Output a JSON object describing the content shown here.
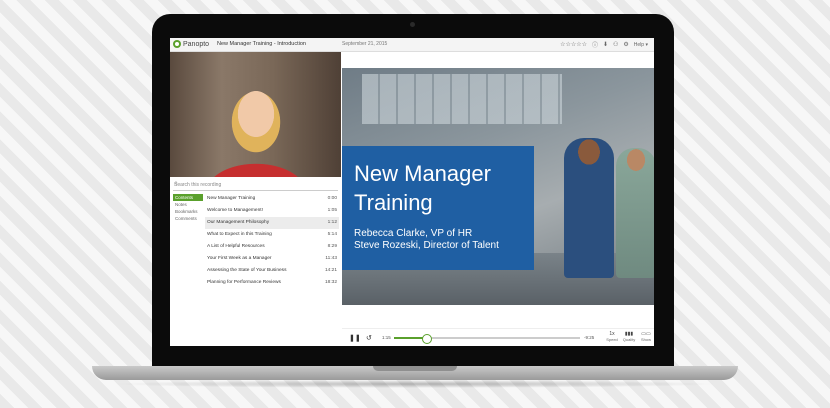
{
  "app": {
    "logo_text": "Panopto",
    "title": "New Manager Training - Introduction",
    "date": "September 21, 2015",
    "icons": [
      "star-icon",
      "info-icon",
      "download-icon",
      "share-icon",
      "settings-icon"
    ],
    "help_label": "Help"
  },
  "sidebar": {
    "search_placeholder": "Search this recording",
    "nav": [
      "Contents",
      "Notes",
      "Bookmarks",
      "Comments"
    ],
    "active_nav": "Contents",
    "contents": [
      {
        "title": "New Manager Training",
        "time": "0:00"
      },
      {
        "title": "Welcome to Management!",
        "time": "1:05"
      },
      {
        "title": "Our Management Philosophy",
        "time": "1:12",
        "highlighted": true
      },
      {
        "title": "What to Expect in this Training",
        "time": "5:14"
      },
      {
        "title": "A List of Helpful Resources",
        "time": "8:29"
      },
      {
        "title": "Your First Week as a Manager",
        "time": "11:43"
      },
      {
        "title": "Assessing the State of Your Business",
        "time": "14:21"
      },
      {
        "title": "Planning for Performance Reviews",
        "time": "18:32"
      }
    ]
  },
  "slide": {
    "title": "New Manager Training",
    "presenter_1": "Rebecca Clarke, VP of HR",
    "presenter_2": "Steve Rozeski, Director of Talent",
    "accent_color": "#1f5fa3"
  },
  "player": {
    "elapsed": "1:15",
    "remaining": "-9:25",
    "progress": 0.17,
    "speed_label": "Speed",
    "speed_value": "1x",
    "quality_label": "Quality",
    "show_label": "Show",
    "accent_color": "#5aa02c"
  }
}
